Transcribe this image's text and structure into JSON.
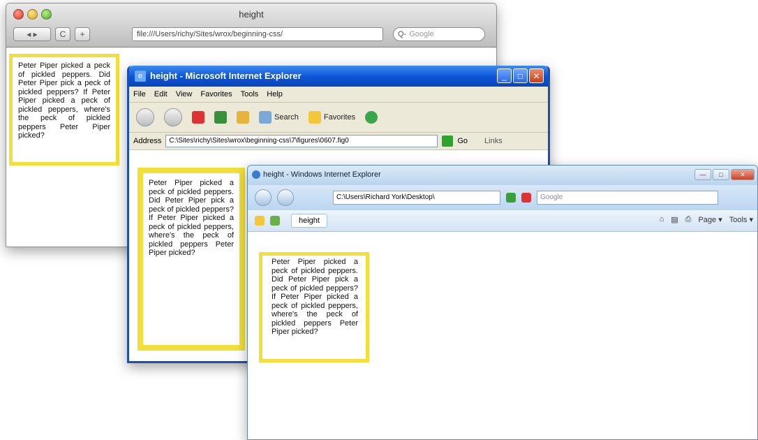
{
  "paragraph": "Peter Piper picked a peck of pickled peppers. Did Peter Piper pick a peck of pickled peppers? If Peter Piper picked a peck of pickled peppers, where's the peck of pickled peppers Peter Piper picked?",
  "safari": {
    "title": "height",
    "back_forward": "◂ ▸",
    "reload": "C",
    "add": "+",
    "url": "file:///Users/richy/Sites/wrox/beginning-css/",
    "search_placeholder": "Google",
    "search_icon": "Q-"
  },
  "ie6": {
    "title": "height - Microsoft Internet Explorer",
    "menu": [
      "File",
      "Edit",
      "View",
      "Favorites",
      "Tools",
      "Help"
    ],
    "toolbar": {
      "search": "Search",
      "favorites": "Favorites"
    },
    "address_label": "Address",
    "address": "C:\\Sites\\richy\\Sites\\wrox\\beginning-css\\7\\figures\\0607.fig0",
    "go": "Go",
    "links": "Links"
  },
  "ie7": {
    "title": "height - Windows Internet Explorer",
    "address": "C:\\Users\\Richard York\\Desktop\\",
    "search_placeholder": "Google",
    "tab": "height",
    "commands": [
      "Page ▾",
      "Tools ▾"
    ]
  },
  "colors": {
    "highlight": "#f2df3a",
    "xp_blue": "#0b53d6",
    "vista_blue": "#bcd6ef"
  }
}
